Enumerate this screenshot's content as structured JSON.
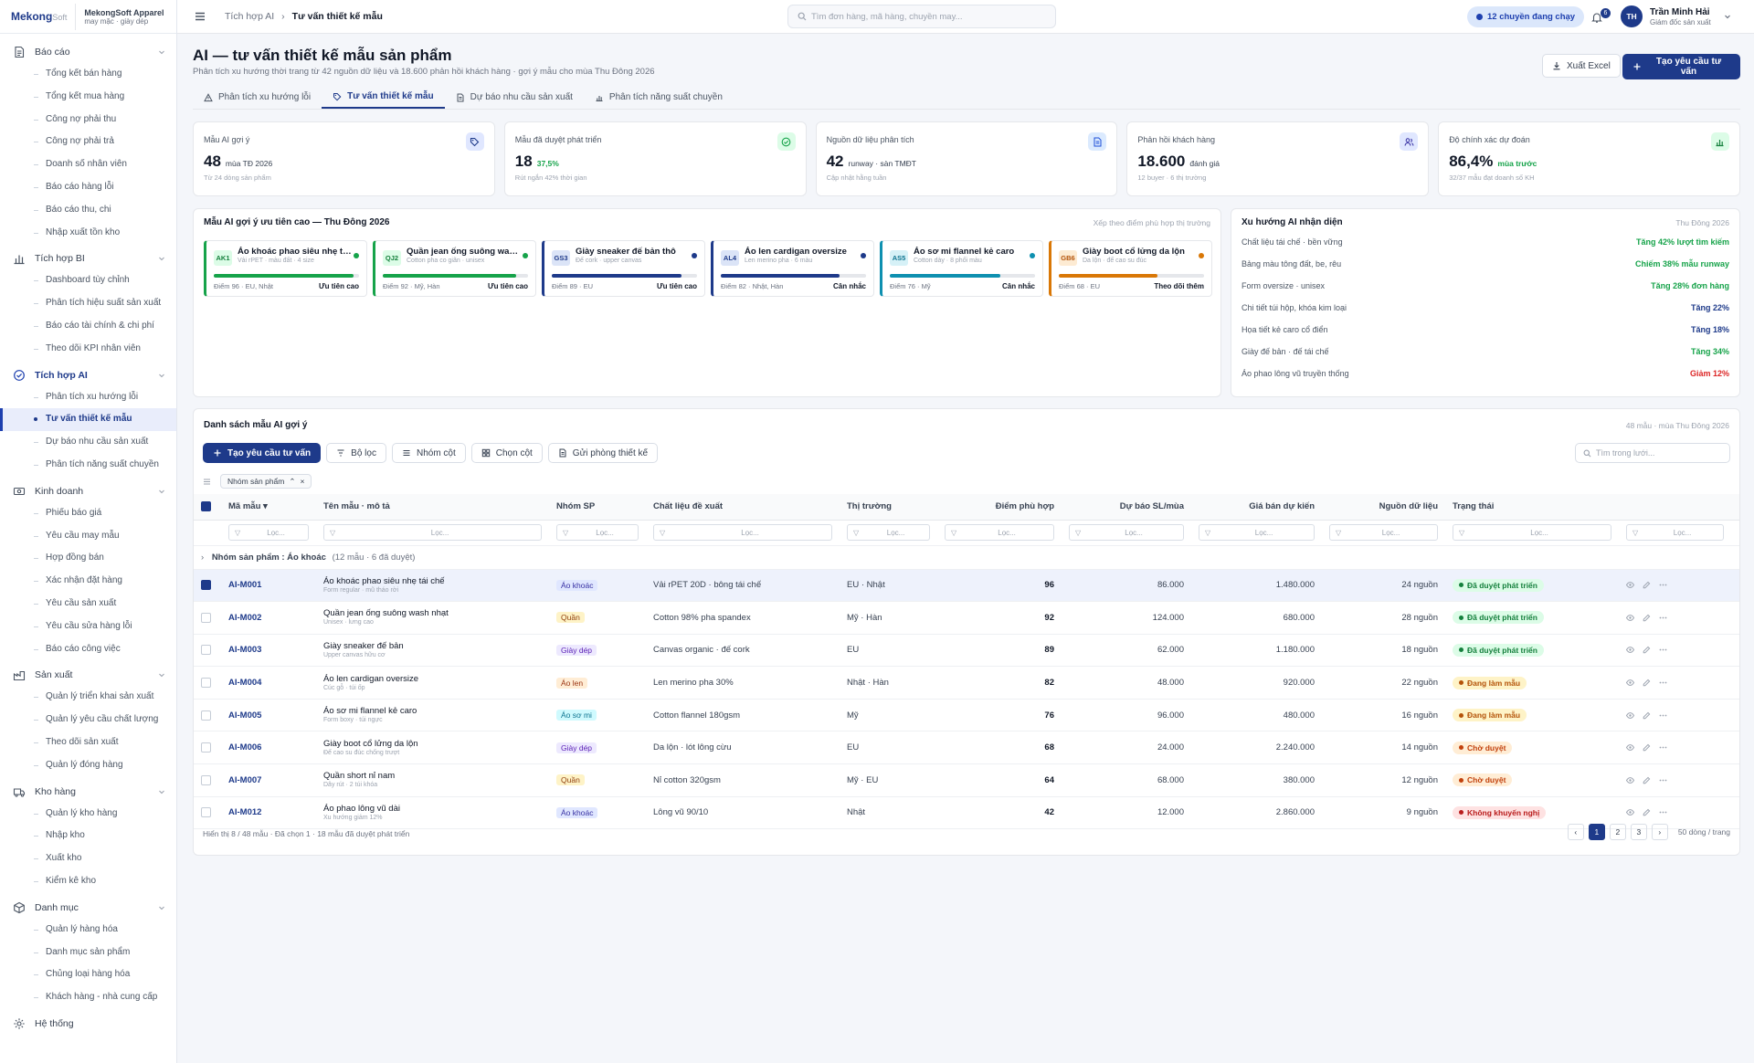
{
  "brand": {
    "logo_main": "Mekong",
    "logo_sub": "Soft",
    "company": "MekongSoft Apparel",
    "tagline": "may mặc · giày dép"
  },
  "sidebar": {
    "groups": [
      {
        "label": "Báo cáo",
        "items": [
          "Tổng kết bán hàng",
          "Tổng kết mua hàng",
          "Công nợ phải thu",
          "Công nợ phải trả",
          "Doanh số nhân viên",
          "Báo cáo hàng lỗi",
          "Báo cáo thu, chi",
          "Nhập xuất tồn kho"
        ]
      },
      {
        "label": "Tích hợp BI",
        "items": [
          "Dashboard tùy chỉnh",
          "Phân tích hiệu suất sản xuất",
          "Báo cáo tài chính & chi phí",
          "Theo dõi KPI nhân viên"
        ]
      },
      {
        "label": "Tích hợp AI",
        "items": [
          "Phân tích xu hướng lỗi",
          "Tư vấn thiết kế mẫu",
          "Dự báo nhu cầu sản xuất",
          "Phân tích năng suất chuyền"
        ]
      },
      {
        "label": "Kinh doanh",
        "items": [
          "Phiếu báo giá",
          "Yêu cầu may mẫu",
          "Hợp đồng bán",
          "Xác nhận đặt hàng",
          "Yêu cầu sản xuất",
          "Yêu cầu sửa hàng lỗi",
          "Báo cáo công việc"
        ]
      },
      {
        "label": "Sản xuất",
        "items": [
          "Quản lý triển khai sản xuất",
          "Quản lý yêu cầu chất lượng",
          "Theo dõi sản xuất",
          "Quản lý đóng hàng"
        ]
      },
      {
        "label": "Kho hàng",
        "items": [
          "Quản lý kho hàng",
          "Nhập kho",
          "Xuất kho",
          "Kiểm kê kho"
        ]
      },
      {
        "label": "Danh mục",
        "items": [
          "Quản lý hàng hóa",
          "Danh mục sản phẩm",
          "Chủng loại hàng hóa",
          "Khách hàng - nhà cung cấp"
        ]
      }
    ],
    "system": "Hệ thống"
  },
  "topbar": {
    "crumb_root": "Tích hợp AI",
    "crumb_current": "Tư vấn thiết kế mẫu",
    "search_placeholder": "Tìm đơn hàng, mã hàng, chuyền may...",
    "running": "12 chuyền đang chạy",
    "notif_count": "6",
    "user_initials": "TH",
    "user_name": "Trần Minh Hải",
    "user_role": "Giám đốc sản xuất"
  },
  "page": {
    "title": "AI — tư vấn thiết kế mẫu sản phẩm",
    "subtitle": "Phân tích xu hướng thời trang từ 42 nguồn dữ liệu và 18.600 phản hồi khách hàng · gợi ý mẫu cho mùa Thu Đông 2026",
    "export_label": "Xuất Excel",
    "create_label": "Tạo yêu cầu tư vấn",
    "tabs": [
      "Phân tích xu hướng lỗi",
      "Tư vấn thiết kế mẫu",
      "Dự báo nhu cầu sản xuất",
      "Phân tích năng suất chuyền"
    ]
  },
  "kpis": [
    {
      "label": "Mẫu AI gợi ý",
      "value": "48",
      "unit": "mùa TĐ 2026",
      "note": "Từ 24 dòng sản phẩm",
      "icon": "tag-icon"
    },
    {
      "label": "Mẫu đã duyệt phát triển",
      "value": "18",
      "unit": "37,5%",
      "note": "Rút ngắn 42% thời gian",
      "icon": "check-circle-icon"
    },
    {
      "label": "Nguồn dữ liệu phân tích",
      "value": "42",
      "unit": "runway · sàn TMĐT",
      "note": "Cập nhật hằng tuần",
      "icon": "document-icon"
    },
    {
      "label": "Phản hồi khách hàng",
      "value": "18.600",
      "unit": "đánh giá",
      "note": "12 buyer · 6 thị trường",
      "icon": "users-icon"
    },
    {
      "label": "Độ chính xác dự đoán",
      "value": "86,4%",
      "unit": "mùa trước",
      "note": "32/37 mẫu đạt doanh số KH",
      "icon": "chart-icon"
    }
  ],
  "suggest": {
    "title": "Mẫu AI gợi ý ưu tiên cao — Thu Đông 2026",
    "sort": "Xếp theo điểm phù hợp thị trường",
    "cards": [
      {
        "code": "AK1",
        "name": "Áo khoác phao siêu nhẹ tái chế",
        "desc": "Vải rPET · màu đất · 4 size",
        "meta": "Điểm 96 · EU, Nhật",
        "tag": "Ưu tiên cao",
        "score": 96,
        "color": "#16a34a",
        "codebg": "#dcfce7",
        "codefg": "#15803d"
      },
      {
        "code": "QJ2",
        "name": "Quần jean ống suông wash nhạt",
        "desc": "Cotton pha co giãn · unisex",
        "meta": "Điểm 92 · Mỹ, Hàn",
        "tag": "Ưu tiên cao",
        "score": 92,
        "color": "#16a34a",
        "codebg": "#dcfce7",
        "codefg": "#15803d"
      },
      {
        "code": "GS3",
        "name": "Giày sneaker đế bản thô",
        "desc": "Đế cork · upper canvas",
        "meta": "Điểm 89 · EU",
        "tag": "Ưu tiên cao",
        "score": 89,
        "color": "#1e3a8a",
        "codebg": "#dbe4f7",
        "codefg": "#1e3a8a"
      },
      {
        "code": "AL4",
        "name": "Áo len cardigan oversize",
        "desc": "Len merino pha · 6 màu",
        "meta": "Điểm 82 · Nhật, Hàn",
        "tag": "Cân nhắc",
        "score": 82,
        "color": "#1e3a8a",
        "codebg": "#dbe4f7",
        "codefg": "#1e3a8a"
      },
      {
        "code": "AS5",
        "name": "Áo sơ mi flannel kẻ caro",
        "desc": "Cotton dày · 8 phối màu",
        "meta": "Điểm 76 · Mỹ",
        "tag": "Cân nhắc",
        "score": 76,
        "color": "#0e90b0",
        "codebg": "#d6f1f7",
        "codefg": "#0e7490"
      },
      {
        "code": "GB6",
        "name": "Giày boot cổ lửng da lộn",
        "desc": "Da lộn · đế cao su đúc",
        "meta": "Điểm 68 · EU",
        "tag": "Theo dõi thêm",
        "score": 68,
        "color": "#d97706",
        "codebg": "#fdebd3",
        "codefg": "#b45309"
      }
    ]
  },
  "trends": {
    "title": "Xu hướng AI nhận diện",
    "season": "Thu Đông 2026",
    "rows": [
      {
        "label": "Chất liệu tái chế · bền vững",
        "value": "Tăng 42% lượt tìm kiếm",
        "color": "#16a34a"
      },
      {
        "label": "Bảng màu tông đất, be, rêu",
        "value": "Chiếm 38% mẫu runway",
        "color": "#16a34a"
      },
      {
        "label": "Form oversize · unisex",
        "value": "Tăng 28% đơn hàng",
        "color": "#16a34a"
      },
      {
        "label": "Chi tiết túi hộp, khóa kim loại",
        "value": "Tăng 22%",
        "color": "#1e3a8a"
      },
      {
        "label": "Họa tiết kẻ caro cổ điển",
        "value": "Tăng 18%",
        "color": "#1e3a8a"
      },
      {
        "label": "Giày đế bản · đế tái chế",
        "value": "Tăng 34%",
        "color": "#16a34a"
      },
      {
        "label": "Áo phao lông vũ truyền thống",
        "value": "Giảm 12%",
        "color": "#dc2626"
      }
    ]
  },
  "list": {
    "title": "Danh sách mẫu AI gợi ý",
    "meta": "48 mẫu · mùa Thu Đông 2026",
    "toolbar": [
      "Tạo yêu cầu tư vấn",
      "Bộ lọc",
      "Nhóm cột",
      "Chọn cột",
      "Gửi phòng thiết kế"
    ],
    "search_placeholder": "Tìm trong lưới...",
    "group_chip": "Nhóm sản phẩm",
    "columns": [
      "Mã mẫu",
      "Tên mẫu · mô tả",
      "Nhóm SP",
      "Chất liệu đề xuất",
      "Thị trường",
      "Điểm phù hợp",
      "Dự báo SL/mùa",
      "Giá bán dự kiến",
      "Nguồn dữ liệu",
      "Trạng thái"
    ],
    "filter_placeholder": "Lọc...",
    "group_label": "Nhóm sản phẩm",
    "group_value": "Áo khoác",
    "group_count": "(12 mẫu · 6 đã duyệt)",
    "rows": [
      {
        "code": "AI-M001",
        "name": "Áo khoác phao siêu nhẹ tái chế",
        "desc": "Form regular · mũ tháo rời",
        "cat": "Áo khoác",
        "catbg": "#e0e7ff",
        "catfg": "#3730a3",
        "mat": "Vải rPET 20D · bông tái chế",
        "market": "EU · Nhật",
        "score": "96",
        "fc": "86.000",
        "price": "1.480.000",
        "src": "24 nguồn",
        "status": "Đã duyệt phát triển",
        "stbg": "#dcfce7",
        "stfg": "#15803d",
        "sel": true
      },
      {
        "code": "AI-M002",
        "name": "Quần jean ống suông wash nhạt",
        "desc": "Unisex · lưng cao",
        "cat": "Quần",
        "catbg": "#fef3c7",
        "catfg": "#92400e",
        "mat": "Cotton 98% pha spandex",
        "market": "Mỹ · Hàn",
        "score": "92",
        "fc": "124.000",
        "price": "680.000",
        "src": "28 nguồn",
        "status": "Đã duyệt phát triển",
        "stbg": "#dcfce7",
        "stfg": "#15803d",
        "sel": false
      },
      {
        "code": "AI-M003",
        "name": "Giày sneaker đế bản",
        "desc": "Upper canvas hữu cơ",
        "cat": "Giày dép",
        "catbg": "#ede9fe",
        "catfg": "#5b21b6",
        "mat": "Canvas organic · đế cork",
        "market": "EU",
        "score": "89",
        "fc": "62.000",
        "price": "1.180.000",
        "src": "18 nguồn",
        "status": "Đã duyệt phát triển",
        "stbg": "#dcfce7",
        "stfg": "#15803d",
        "sel": false
      },
      {
        "code": "AI-M004",
        "name": "Áo len cardigan oversize",
        "desc": "Cúc gỗ · túi ốp",
        "cat": "Áo len",
        "catbg": "#ffedd5",
        "catfg": "#9a3412",
        "mat": "Len merino pha 30%",
        "market": "Nhật · Hàn",
        "score": "82",
        "fc": "48.000",
        "price": "920.000",
        "src": "22 nguồn",
        "status": "Đang làm mẫu",
        "stbg": "#fef3c7",
        "stfg": "#b45309",
        "sel": false
      },
      {
        "code": "AI-M005",
        "name": "Áo sơ mi flannel kẻ caro",
        "desc": "Form boxy · túi ngực",
        "cat": "Áo sơ mi",
        "catbg": "#cffafe",
        "catfg": "#0e7490",
        "mat": "Cotton flannel 180gsm",
        "market": "Mỹ",
        "score": "76",
        "fc": "96.000",
        "price": "480.000",
        "src": "16 nguồn",
        "status": "Đang làm mẫu",
        "stbg": "#fef3c7",
        "stfg": "#b45309",
        "sel": false
      },
      {
        "code": "AI-M006",
        "name": "Giày boot cổ lửng da lộn",
        "desc": "Đế cao su đúc chống trượt",
        "cat": "Giày dép",
        "catbg": "#ede9fe",
        "catfg": "#5b21b6",
        "mat": "Da lộn · lót lông cừu",
        "market": "EU",
        "score": "68",
        "fc": "24.000",
        "price": "2.240.000",
        "src": "14 nguồn",
        "status": "Chờ duyệt",
        "stbg": "#ffedd5",
        "stfg": "#c2410c",
        "sel": false
      },
      {
        "code": "AI-M007",
        "name": "Quần short nỉ nam",
        "desc": "Dây rút · 2 túi khóa",
        "cat": "Quần",
        "catbg": "#fef3c7",
        "catfg": "#92400e",
        "mat": "Nỉ cotton 320gsm",
        "market": "Mỹ · EU",
        "score": "64",
        "fc": "68.000",
        "price": "380.000",
        "src": "12 nguồn",
        "status": "Chờ duyệt",
        "stbg": "#ffedd5",
        "stfg": "#c2410c",
        "sel": false
      },
      {
        "code": "AI-M012",
        "name": "Áo phao lông vũ dài",
        "desc": "Xu hướng giảm 12%",
        "cat": "Áo khoác",
        "catbg": "#e0e7ff",
        "catfg": "#3730a3",
        "mat": "Lông vũ 90/10",
        "market": "Nhật",
        "score": "42",
        "fc": "12.000",
        "price": "2.860.000",
        "src": "9 nguồn",
        "status": "Không khuyến nghị",
        "stbg": "#fee2e2",
        "stfg": "#b91c1c",
        "sel": false
      }
    ],
    "footer": "Hiển thị 8 / 48 mẫu · Đã chọn 1 · 18 mẫu đã duyệt phát triển",
    "pages": [
      "1",
      "2",
      "3"
    ],
    "per_page": "50 dòng / trang"
  },
  "colors": {
    "primary": "#1e3a8a",
    "success": "#16a34a",
    "danger": "#dc2626",
    "warning": "#d97706"
  }
}
